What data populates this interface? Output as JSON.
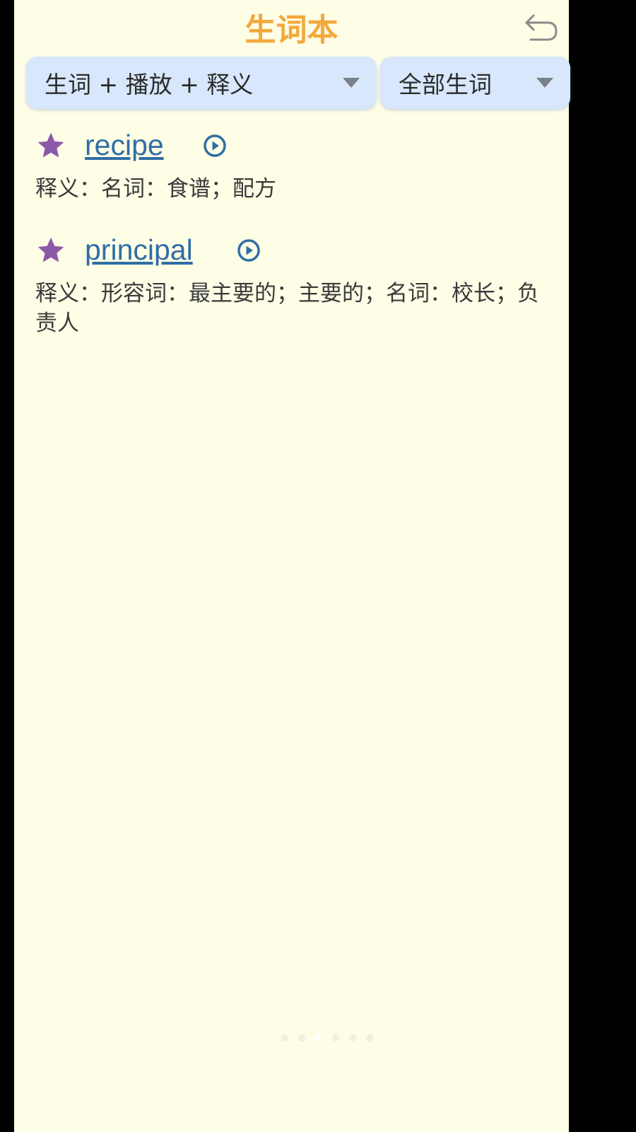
{
  "header": {
    "title": "生词本",
    "back_icon": "undo-arrow-icon",
    "title_color": "#f2a93b"
  },
  "filters": {
    "mode": {
      "selected": "生词 + 播放 + 释义"
    },
    "scope": {
      "selected": "全部生词"
    }
  },
  "words": [
    {
      "word": "recipe",
      "definition": "释义：名词：食谱；配方",
      "starred": true
    },
    {
      "word": "principal",
      "definition": "释义：形容词：最主要的；主要的；名词：校长；负责人",
      "starred": true
    }
  ],
  "colors": {
    "background": "#fefde6",
    "dropdown": "#d8e7fb",
    "link": "#2f6ea5",
    "star": "#8a5aa8"
  },
  "pager": {
    "current": 3,
    "total": 6
  }
}
